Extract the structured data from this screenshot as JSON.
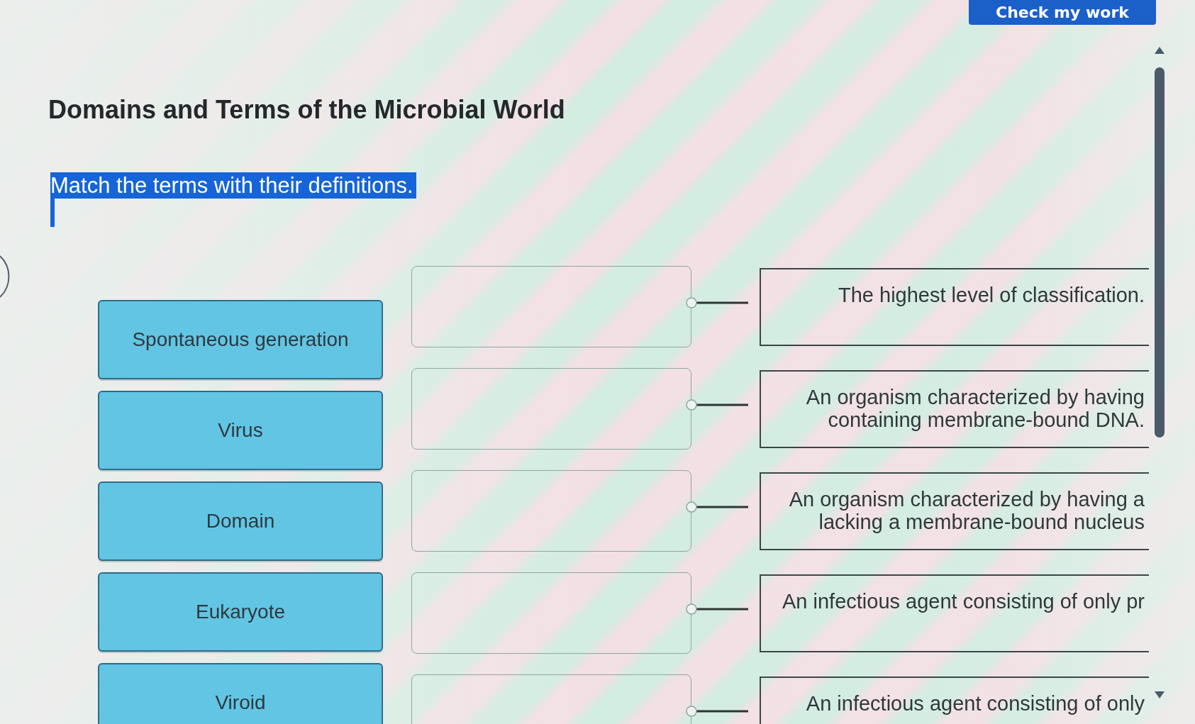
{
  "header": {
    "button": "Check my work"
  },
  "title": "Domains and Terms of the Microbial World",
  "instruction": {
    "text": "Match the terms with their definitions.",
    "highlighted": true
  },
  "terms": [
    "Spontaneous generation",
    "Virus",
    "Domain",
    "Eukaryote",
    "Viroid"
  ],
  "definitions": [
    {
      "lines": [
        "The highest level of classification."
      ]
    },
    {
      "lines": [
        "An organism characterized by having",
        "containing membrane-bound DNA."
      ]
    },
    {
      "lines": [
        "An organism characterized by having a",
        "lacking a membrane-bound nucleus"
      ]
    },
    {
      "lines": [
        "An infectious agent consisting of only pr"
      ]
    },
    {
      "lines": [
        "An infectious agent consisting of only"
      ]
    }
  ]
}
